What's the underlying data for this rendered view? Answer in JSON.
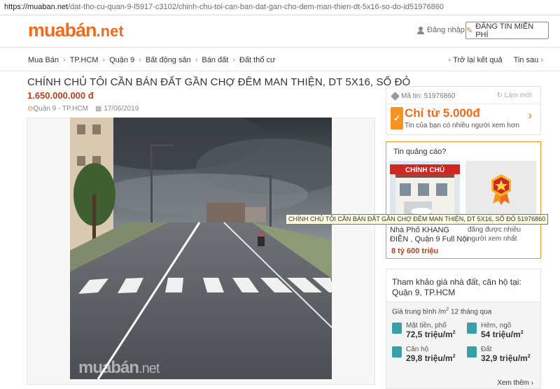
{
  "browser": {
    "url_host": "https://muaban.net",
    "url_path": "/dat-tho-cu-quan-9-l5917-c3102/chinh-chu-toi-can-ban-dat-gan-cho-dem-man-thien-dt-5x16-so-do-id51976860"
  },
  "header": {
    "logo_main": "muabán",
    "logo_suffix": ".net",
    "login_label": "Đăng nhập",
    "post_button_label": "ĐĂNG TIN MIỄN PHÍ"
  },
  "breadcrumb": {
    "items": [
      "Mua Bán",
      "TP.HCM",
      "Quận 9",
      "Bất động sản",
      "Bán đất",
      "Đất thổ cư"
    ],
    "back_label": "Trở lại kết quả",
    "next_label": "Tin sau"
  },
  "listing": {
    "title": "CHÍNH CHỦ TÔI CẦN BÁN ĐẤT GẦN CHỢ ĐÊM MAN THIỆN, DT 5X16, SỔ ĐỎ",
    "price": "1.650.000.000 đ",
    "location": "Quận 9 - TP.HCM",
    "date": "17/06/2019",
    "watermark_main": "muabán",
    "watermark_suffix": ".net"
  },
  "sidebar": {
    "id_label": "Mã tin: 51976860",
    "refresh_label": "Làm mới",
    "promo_price": "Chỉ từ 5.000đ",
    "promo_sub": "Tin của bạn có nhiều người xem hơn",
    "ads_heading": "Tin quảng cáo?",
    "ad1_badge": "CHÍNH CHỦ",
    "ad1_line1": "Nhà Phố KHANG",
    "ad1_line2": "ĐIỀN , Quận 9 Full Nội",
    "ad1_price": "8 tỷ 600 triệu",
    "ad2_line1": "đăng được nhiều",
    "ad2_line2": "người xem nhất",
    "tooltip": "CHÍNH CHỦ TÔI CẦN BÁN ĐẤT GẦN CHỢ ĐÊM MAN THIỆN, DT 5X16, SỔ ĐỎ 51976860"
  },
  "price_ref": {
    "heading": "Tham khảo giá nhà đất, căn hộ tại:",
    "place": "Quận 9, TP.HCM",
    "avg_label_a": "Giá trung bình /m",
    "avg_label_b": " 12 tháng qua",
    "stats": [
      {
        "label": "Mặt tiền, phố",
        "value": "72,5 triệu/m"
      },
      {
        "label": "Hẻm, ngõ",
        "value": "54 triệu/m"
      },
      {
        "label": "Căn hộ",
        "value": "29,8 triệu/m"
      },
      {
        "label": "Đất",
        "value": "32,9 triệu/m"
      }
    ],
    "sq": "2",
    "more_label": "Xem thêm"
  },
  "colors": {
    "brand": "#f26b1d",
    "price": "#b5441a",
    "accent_teal": "#3aa0a8"
  }
}
